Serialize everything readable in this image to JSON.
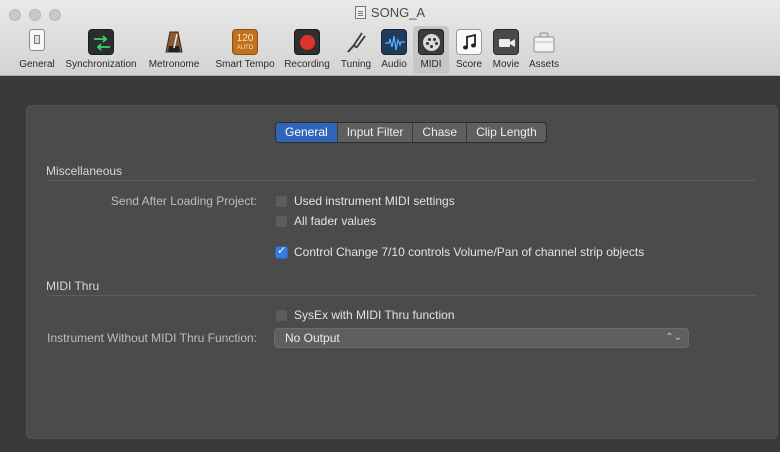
{
  "window": {
    "title": "SONG_A"
  },
  "toolbar": {
    "items": [
      {
        "label": "General",
        "icon": "switch-icon"
      },
      {
        "label": "Synchronization",
        "icon": "sync-arrows-icon"
      },
      {
        "label": "Metronome",
        "icon": "metronome-icon"
      },
      {
        "label": "Smart Tempo",
        "icon": "smart-tempo-icon",
        "badge": "120",
        "badge_sub": "AUTO"
      },
      {
        "label": "Recording",
        "icon": "record-icon"
      },
      {
        "label": "Tuning",
        "icon": "tuning-fork-icon"
      },
      {
        "label": "Audio",
        "icon": "audio-waveform-icon"
      },
      {
        "label": "MIDI",
        "icon": "midi-port-icon",
        "selected": true
      },
      {
        "label": "Score",
        "icon": "music-note-icon"
      },
      {
        "label": "Movie",
        "icon": "movie-camera-icon"
      },
      {
        "label": "Assets",
        "icon": "briefcase-icon"
      }
    ]
  },
  "tabs": [
    {
      "label": "General",
      "active": true
    },
    {
      "label": "Input Filter"
    },
    {
      "label": "Chase"
    },
    {
      "label": "Clip Length"
    }
  ],
  "misc": {
    "heading": "Miscellaneous",
    "send_label": "Send After Loading Project:",
    "options": [
      {
        "label": "Used instrument MIDI settings",
        "checked": false
      },
      {
        "label": "All fader values",
        "checked": false
      },
      {
        "label": "Control Change 7/10 controls Volume/Pan of channel strip objects",
        "checked": true
      }
    ]
  },
  "thru": {
    "heading": "MIDI Thru",
    "sysex_label": "SysEx with MIDI Thru function",
    "sysex_checked": false,
    "instrument_label": "Instrument Without MIDI Thru Function:",
    "instrument_value": "No Output",
    "select_arrows": "⌃⌄"
  },
  "colors": {
    "accent": "#2f66b7",
    "checkbox_checked": "#3b7ae0",
    "record": "#e0322d"
  }
}
